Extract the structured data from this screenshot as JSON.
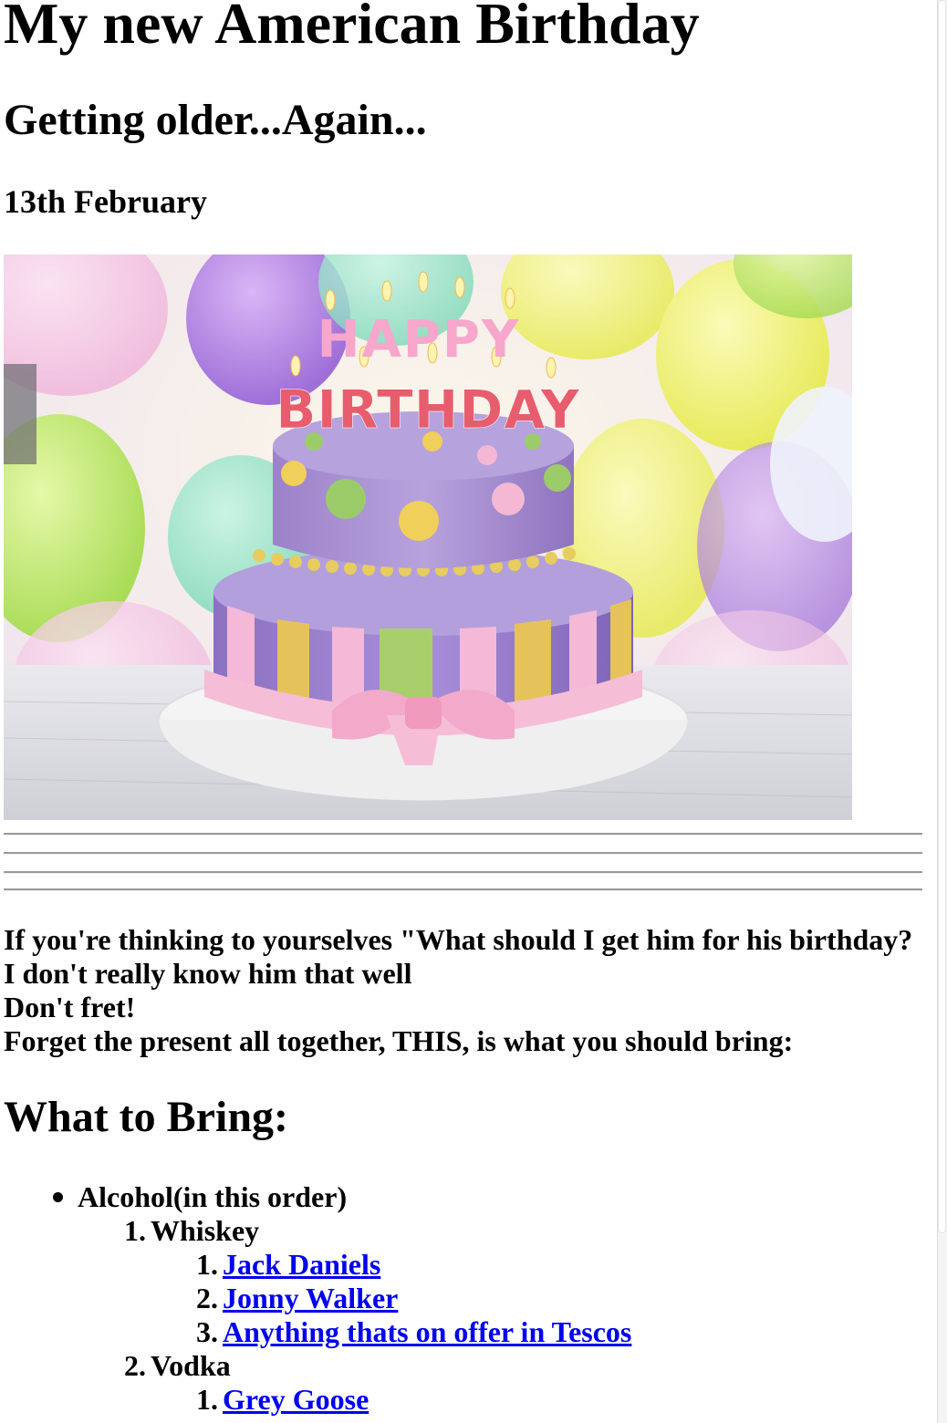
{
  "page": {
    "title": "My new American Birthday",
    "subtitle": "Getting older...Again...",
    "date": "13th February"
  },
  "photo": {
    "cake_text_line1": "HAPPY",
    "cake_text_line2": "BIRTHDAY"
  },
  "intro": {
    "lines": [
      "If you're thinking to yourselves \"What should I get him for his birthday?",
      "I don't really know him that well",
      "Don't fret!",
      "Forget the present all together, THIS, is what you should bring:"
    ]
  },
  "bring": {
    "heading": "What to Bring:",
    "alcohol_label": "Alcohol(in this order)",
    "categories": [
      {
        "number": "1.",
        "label": "Whiskey",
        "items": [
          {
            "number": "1.",
            "label": "Jack Daniels"
          },
          {
            "number": "2.",
            "label": "Jonny Walker"
          },
          {
            "number": "3.",
            "label": "Anything thats on offer in Tescos"
          }
        ]
      },
      {
        "number": "2.",
        "label": "Vodka",
        "items": [
          {
            "number": "1.",
            "label": "Grey Goose"
          }
        ]
      }
    ]
  },
  "colors": {
    "link": "#0000ee",
    "text": "#000000",
    "rule": "#9a9a9a"
  }
}
